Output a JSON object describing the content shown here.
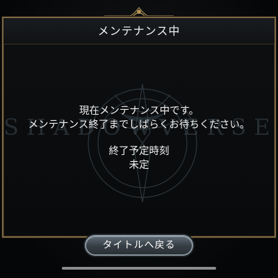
{
  "dialog": {
    "title": "メンテナンス中",
    "watermark": "SHADOWVERSE",
    "message_lines": [
      "現在メンテナンス中です。",
      "メンテナンス終了までしばらくお待ちください。"
    ],
    "schedule_label": "終了予定時刻",
    "schedule_value": "未定",
    "return_button_label": "タイトルへ戻る"
  },
  "icons": {
    "top_ornament": "crown-ornament-icon",
    "emblem": "compass-emblem-icon"
  },
  "colors": {
    "border_gold": "#7f6a45",
    "background": "#050607",
    "text": "#f2f2f2",
    "button": "#4a545c"
  }
}
